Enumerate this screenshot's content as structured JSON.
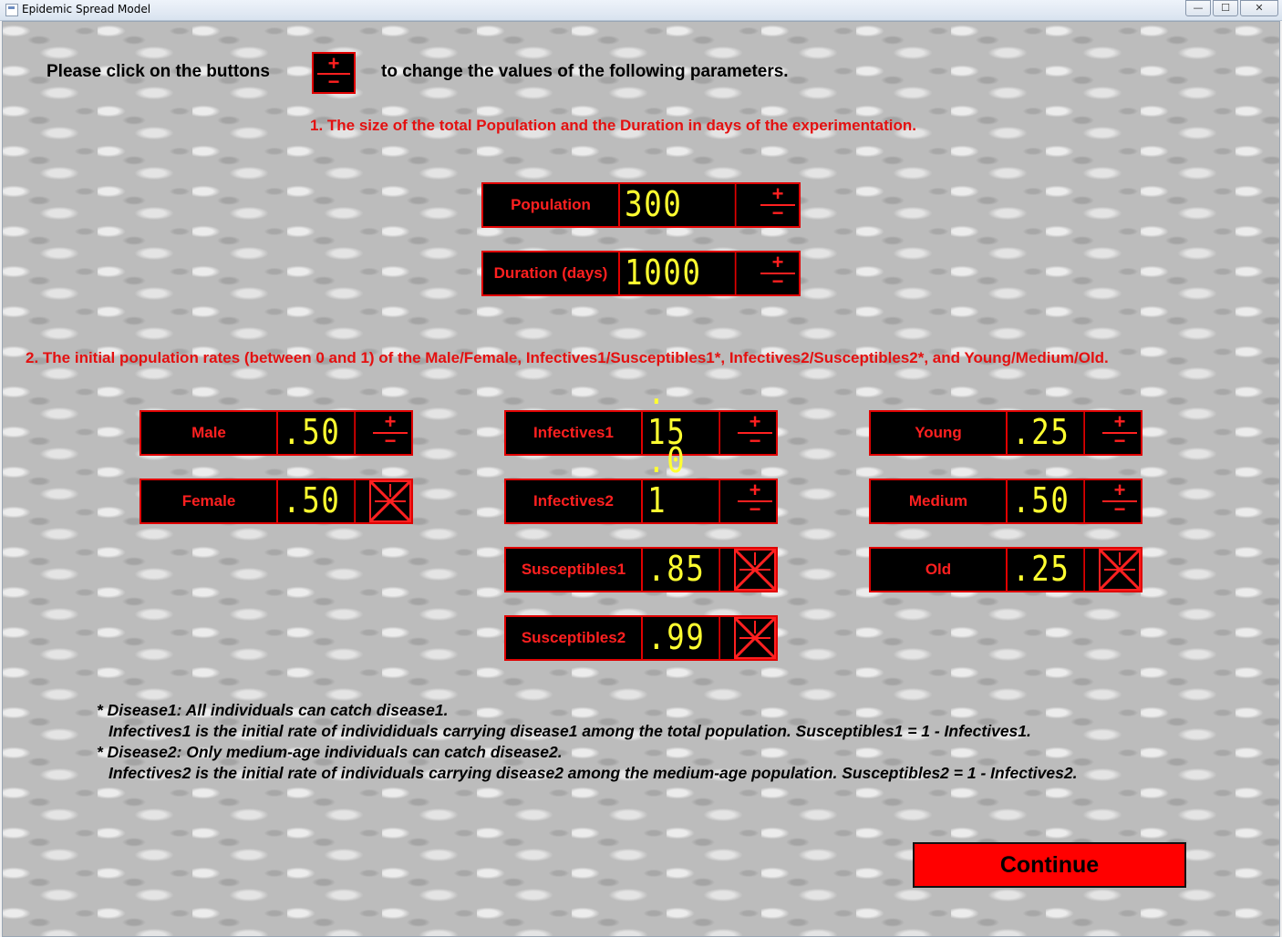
{
  "window": {
    "title": "Epidemic Spread Model",
    "buttons": {
      "minimize": "—",
      "maximize": "☐",
      "close": "✕"
    }
  },
  "instruction": {
    "before": "Please click on the buttons",
    "after": "to change the values of the following parameters.",
    "plus": "+",
    "minus": "−"
  },
  "section1": "1. The size of the total Population and the Duration in days of the experimentation.",
  "section2": "2. The initial population rates (between 0 and 1) of the Male/Female, Infectives1/Susceptibles1*, Infectives2/Susceptibles2*, and Young/Medium/Old.",
  "params": {
    "population": {
      "label": "Population",
      "value": "300"
    },
    "duration": {
      "label": "Duration (days)",
      "value": "1000"
    },
    "male": {
      "label": "Male",
      "value": ".50"
    },
    "female": {
      "label": "Female",
      "value": ".50"
    },
    "infectives1": {
      "label": "Infectives1",
      "value": ". 15"
    },
    "infectives2": {
      "label": "Infectives2",
      "value": ".0 1"
    },
    "susceptibles1": {
      "label": "Susceptibles1",
      "value": ".85"
    },
    "susceptibles2": {
      "label": "Susceptibles2",
      "value": ".99"
    },
    "young": {
      "label": "Young",
      "value": ".25"
    },
    "medium": {
      "label": "Medium",
      "value": ".50"
    },
    "old": {
      "label": "Old",
      "value": ".25"
    }
  },
  "controls": {
    "plus": "+",
    "minus": "−"
  },
  "notes": {
    "line1": "* Disease1: All individuals can catch disease1.",
    "line2": "Infectives1 is the initial rate of individiduals carrying disease1 among the total population. Susceptibles1 = 1 - Infectives1.",
    "line3": "* Disease2: Only medium-age individuals can catch disease2.",
    "line4": "Infectives2 is the initial rate of individuals carrying disease2 among the medium-age population. Susceptibles2 = 1 - Infectives2."
  },
  "continue_label": "Continue",
  "colors": {
    "accent": "#e00000",
    "digits": "#ffff30",
    "panel": "#000000"
  }
}
